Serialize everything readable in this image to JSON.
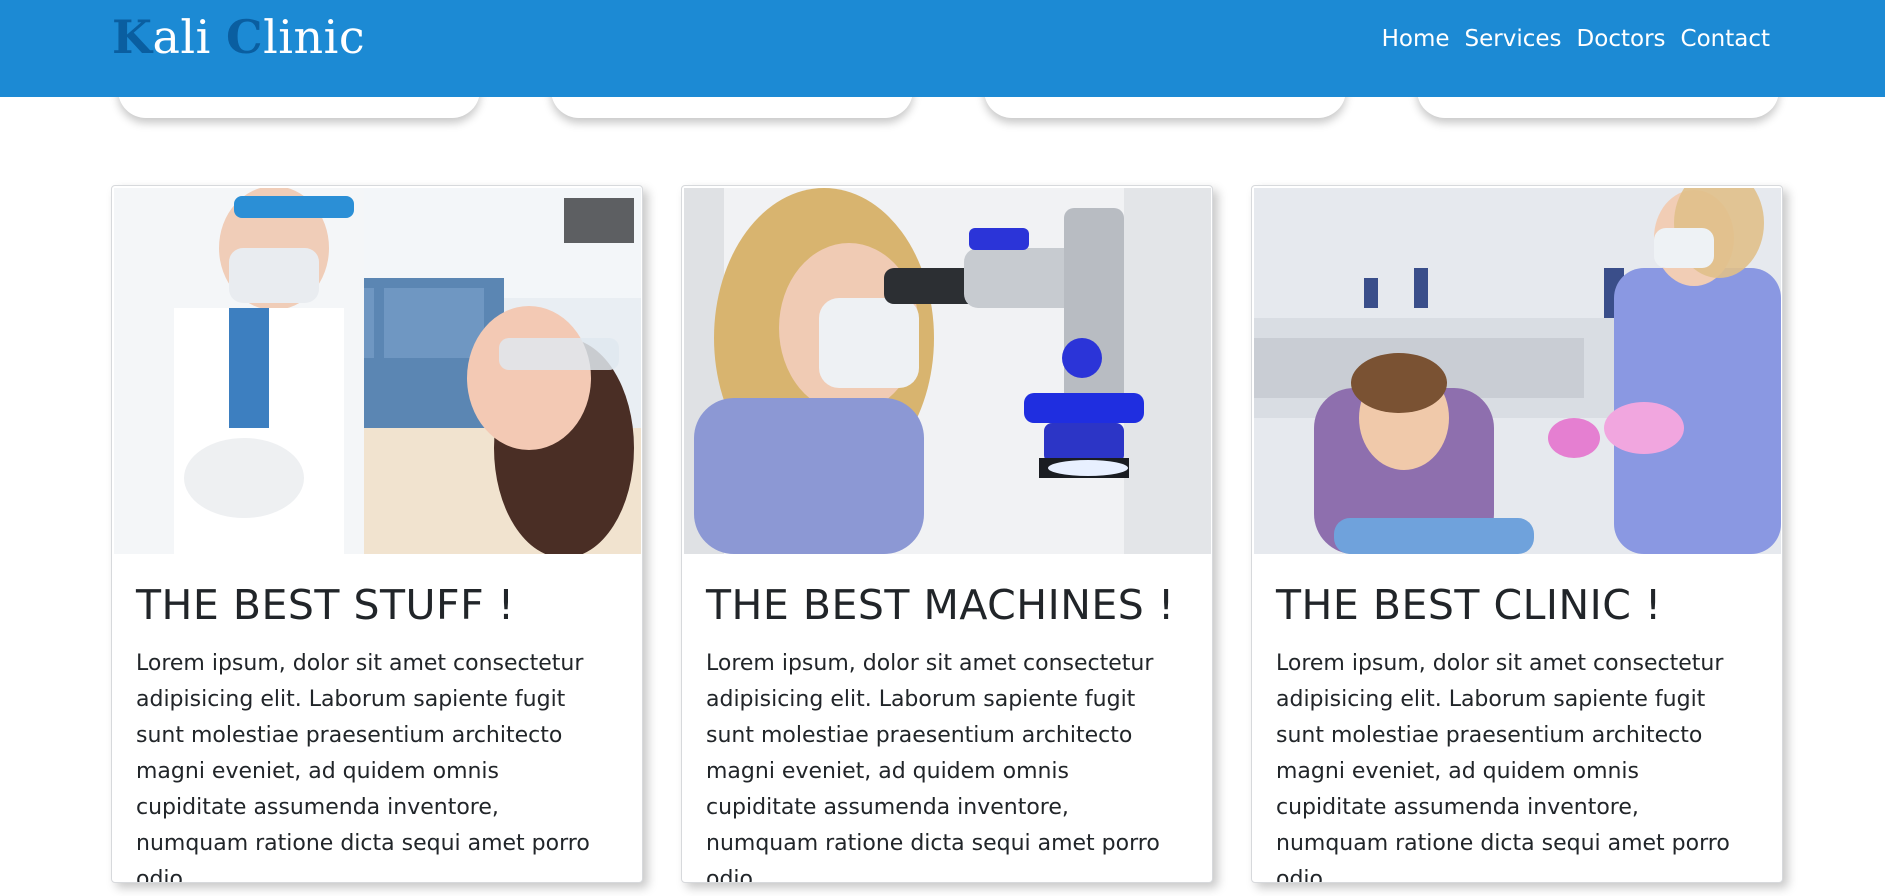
{
  "navbar": {
    "brand_first_initial": "K",
    "brand_first_rest": "ali ",
    "brand_second_initial": "C",
    "brand_second_rest": "linic",
    "links": [
      "Home",
      "Services",
      "Doctors",
      "Contact"
    ]
  },
  "cards": [
    {
      "title": "THE BEST STUFF !",
      "text": "Lorem ipsum, dolor sit amet consectetur adipisicing elit. Laborum sapiente fugit sunt molestiae praesentium architecto magni eveniet, ad quidem omnis cupiditate assumenda inventore, numquam ratione dicta sequi amet porro odio."
    },
    {
      "title": "THE BEST MACHINES !",
      "text": "Lorem ipsum, dolor sit amet consectetur adipisicing elit. Laborum sapiente fugit sunt molestiae praesentium architecto magni eveniet, ad quidem omnis cupiditate assumenda inventore, numquam ratione dicta sequi amet porro odio."
    },
    {
      "title": "THE BEST CLINIC !",
      "text": "Lorem ipsum, dolor sit amet consectetur adipisicing elit. Laborum sapiente fugit sunt molestiae praesentium architecto magni eveniet, ad quidem omnis cupiditate assumenda inventore, numquam ratione dicta sequi amet porro odio."
    }
  ],
  "colors": {
    "navbar": "#1c8ad4",
    "brand_initials": "#0a5ea0",
    "text": "#212529"
  }
}
